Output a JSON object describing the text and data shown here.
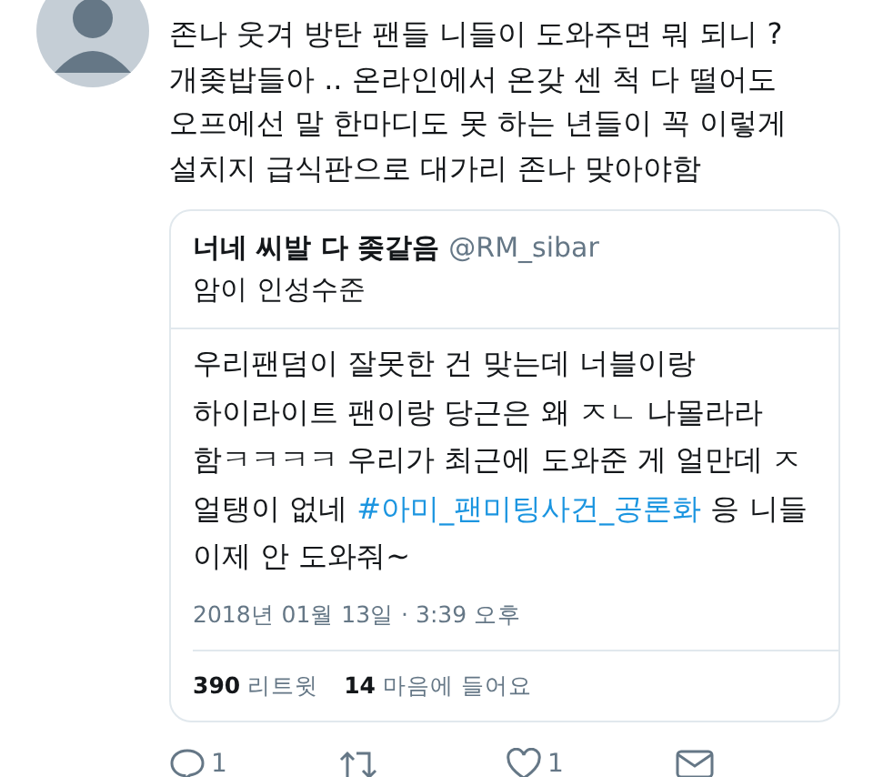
{
  "tweet": {
    "text": "존나 웃겨 방탄 팬들 니들이 도와주면 뭐 되니 ?\n개좆밥들아 .. 온라인에서 온갖 센 척 다 떨어도\n오프에선 말 한마디도 못 하는 년들이 꼭 이렇게\n설치지 급식판으로 대가리 존나 맞아야함",
    "quote": {
      "name": "너네 씨발 다 좆같음",
      "handle": "@RM_sibar",
      "text": "암이 인성수준"
    },
    "retweet": {
      "text_before": "우리팬덤이 잘못한 건 맞는데 너블이랑\n하이라이트 팬이랑 당근은 왜 ㅈㄴ 나몰라라\n함ㅋㅋㅋㅋ 우리가 최근에 도와준 게 얼만데 ㅈ\n얼탱이 없네 ",
      "hashtag": "#아미_팬미팅사건_공론화",
      "text_after": " 응 니들\n이제 안 도와줘~",
      "date": "2018년 01월 13일 · 3:39 오후",
      "stats": [
        {
          "count": "390",
          "label": "리트윗"
        },
        {
          "count": "14",
          "label": "마음에 들어요"
        }
      ]
    },
    "actions": [
      {
        "kind": "reply",
        "count": "1"
      },
      {
        "kind": "retweet"
      },
      {
        "kind": "like",
        "count": "1"
      },
      {
        "kind": "message"
      }
    ]
  }
}
